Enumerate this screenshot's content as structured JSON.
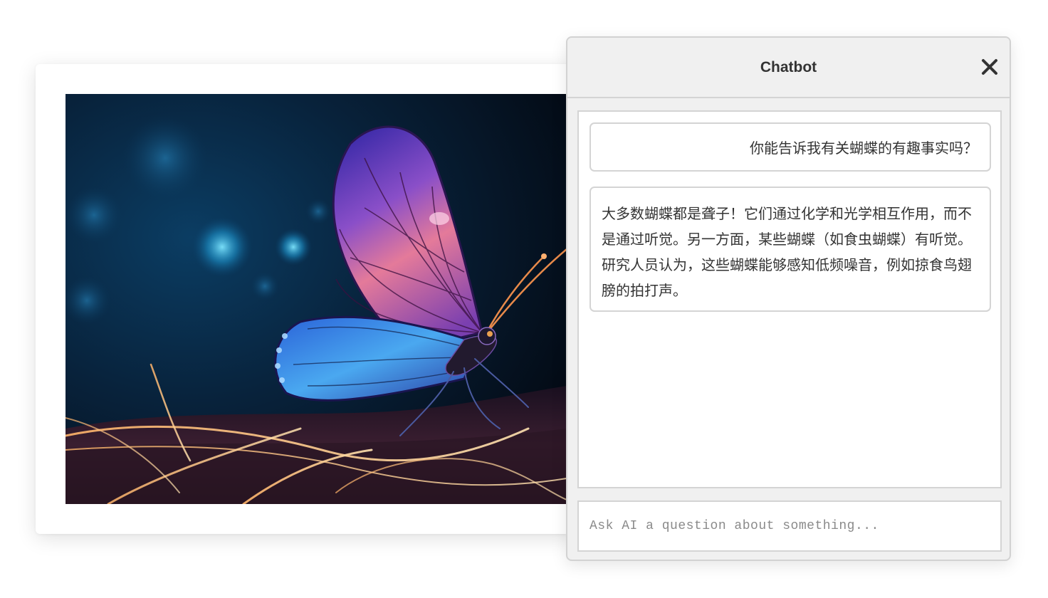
{
  "image": {
    "icon": "butterfly-image",
    "subject": "glowing blue and pink butterfly on light strands"
  },
  "chatbot": {
    "title": "Chatbot",
    "close_icon": "close-icon",
    "messages": [
      {
        "role": "user",
        "text": "你能告诉我有关蝴蝶的有趣事实吗？"
      },
      {
        "role": "assistant",
        "text": "大多数蝴蝶都是聋子！它们通过化学和光学相互作用，而不是通过听觉。另一方面，某些蝴蝶（如食虫蝴蝶）有听觉。研究人员认为，这些蝴蝶能够感知低频噪音，例如掠食鸟翅膀的拍打声。"
      }
    ],
    "input": {
      "placeholder": "Ask AI a question about something...",
      "value": ""
    }
  },
  "colors": {
    "panel_bg": "#f0f0f0",
    "border": "#d4d4d4",
    "text": "#333333",
    "placeholder": "#8a8a8a"
  }
}
